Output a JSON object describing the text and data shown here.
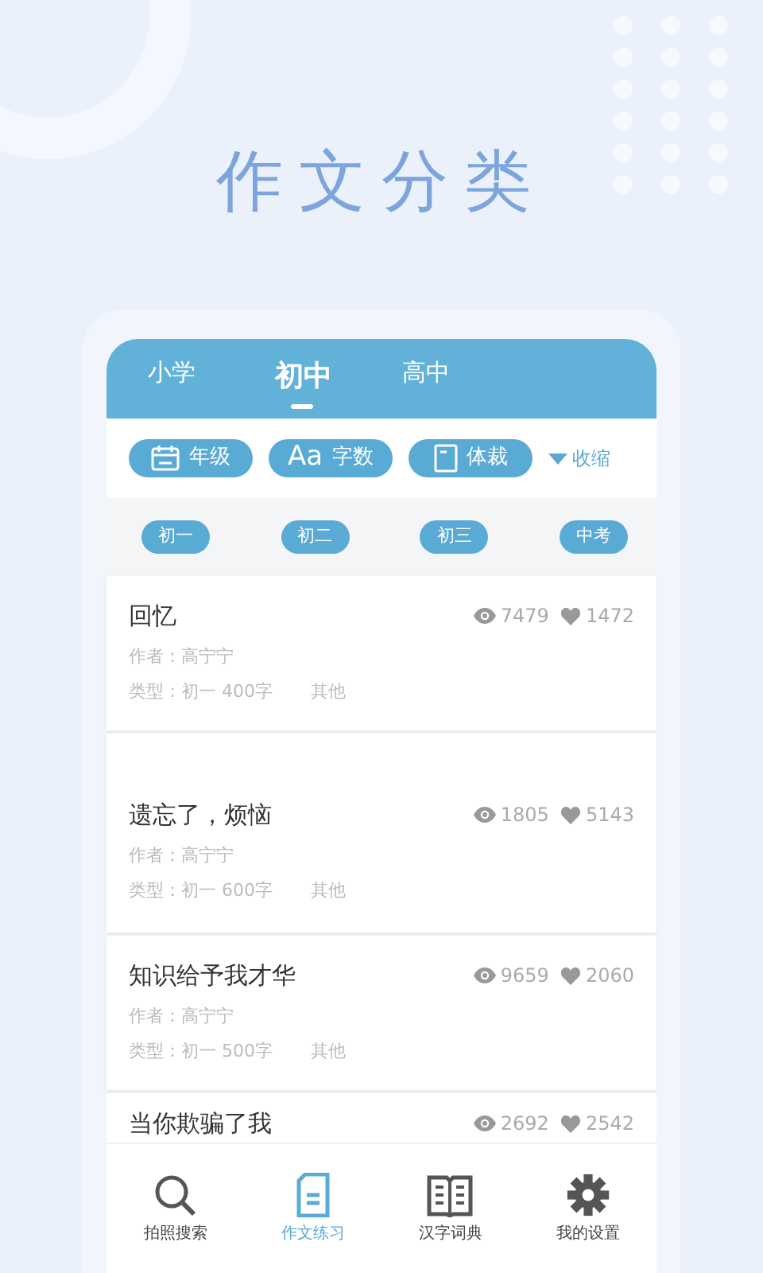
{
  "title": "作文分类",
  "tabs": [
    {
      "label": "小学",
      "selected": false
    },
    {
      "label": "初中",
      "selected": true
    },
    {
      "label": "高中",
      "selected": false
    }
  ],
  "filters": [
    {
      "label": "年级"
    },
    {
      "glyph": "Aa",
      "label": "字数"
    },
    {
      "label": "体裁"
    }
  ],
  "collapse": "收缩",
  "grades": [
    "初一",
    "初二",
    "初三",
    "中考"
  ],
  "essays": [
    {
      "title": "回忆",
      "views": "7479",
      "likes": "1472",
      "author": "作者：高宁宁",
      "type": "类型：初一 400字",
      "genre": "其他"
    },
    {
      "title": "遗忘了，烦恼",
      "views": "1805",
      "likes": "5143",
      "author": "作者：高宁宁",
      "type": "类型：初一 600字",
      "genre": "其他"
    },
    {
      "title": "知识给予我才华",
      "views": "9659",
      "likes": "2060",
      "author": "作者：高宁宁",
      "type": "类型：初一 500字",
      "genre": "其他"
    },
    {
      "title": "当你欺骗了我",
      "views": "2692",
      "likes": "2542"
    }
  ],
  "nav": [
    {
      "label": "拍照搜索",
      "selected": false
    },
    {
      "label": "作文练习",
      "selected": true
    },
    {
      "label": "汉字词典",
      "selected": false
    },
    {
      "label": "我的设置",
      "selected": false
    }
  ]
}
